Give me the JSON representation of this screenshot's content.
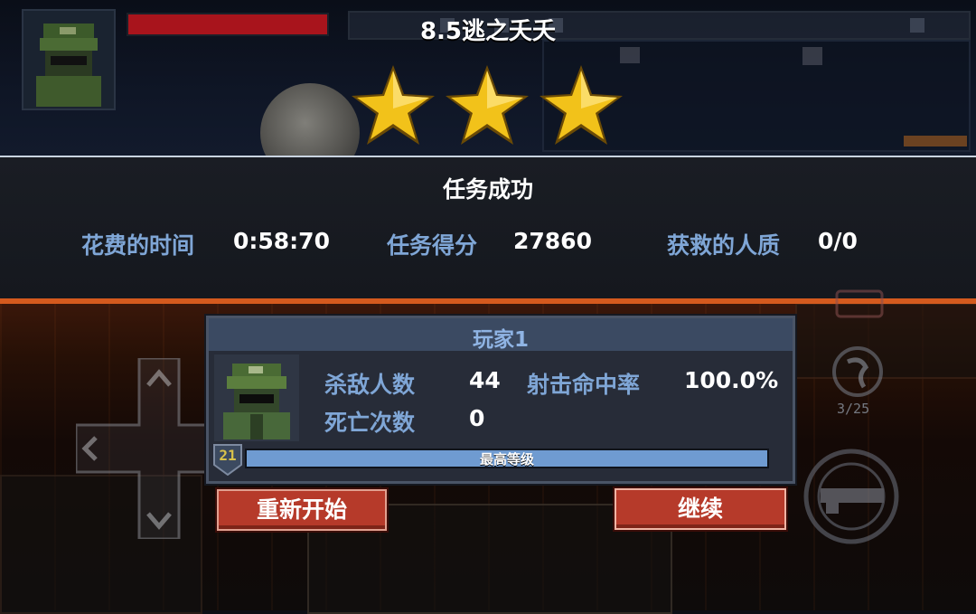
{
  "level": {
    "title": "8.5逃之夭夭",
    "stars": 3
  },
  "result": {
    "title": "任务成功",
    "stats": [
      {
        "label": "花费的时间",
        "value": "0:58:70"
      },
      {
        "label": "任务得分",
        "value": "27860"
      },
      {
        "label": "获救的人质",
        "value": "0/0"
      }
    ]
  },
  "player": {
    "name": "玩家1",
    "kills_label": "杀敌人数",
    "kills": "44",
    "accuracy_label": "射击命中率",
    "accuracy": "100.0%",
    "deaths_label": "死亡次数",
    "deaths": "0",
    "rank_level": "21",
    "xp_label": "最高等级",
    "xp_progress": 1.0
  },
  "buttons": {
    "restart": "重新开始",
    "continue": "继续"
  },
  "hud": {
    "ammo": "3/25",
    "health_fraction": 1.0
  },
  "colors": {
    "accent_orange": "#d45a1e",
    "label_blue": "#7fa6d6",
    "button_red": "#b63a2a",
    "star_gold": "#f2c21a"
  },
  "icons": {
    "star": "star-icon",
    "soldier": "soldier-avatar-icon",
    "rank": "rank-badge-icon",
    "dpad": "dpad-icon",
    "weapon": "weapon-icon",
    "grenade": "grenade-icon"
  }
}
